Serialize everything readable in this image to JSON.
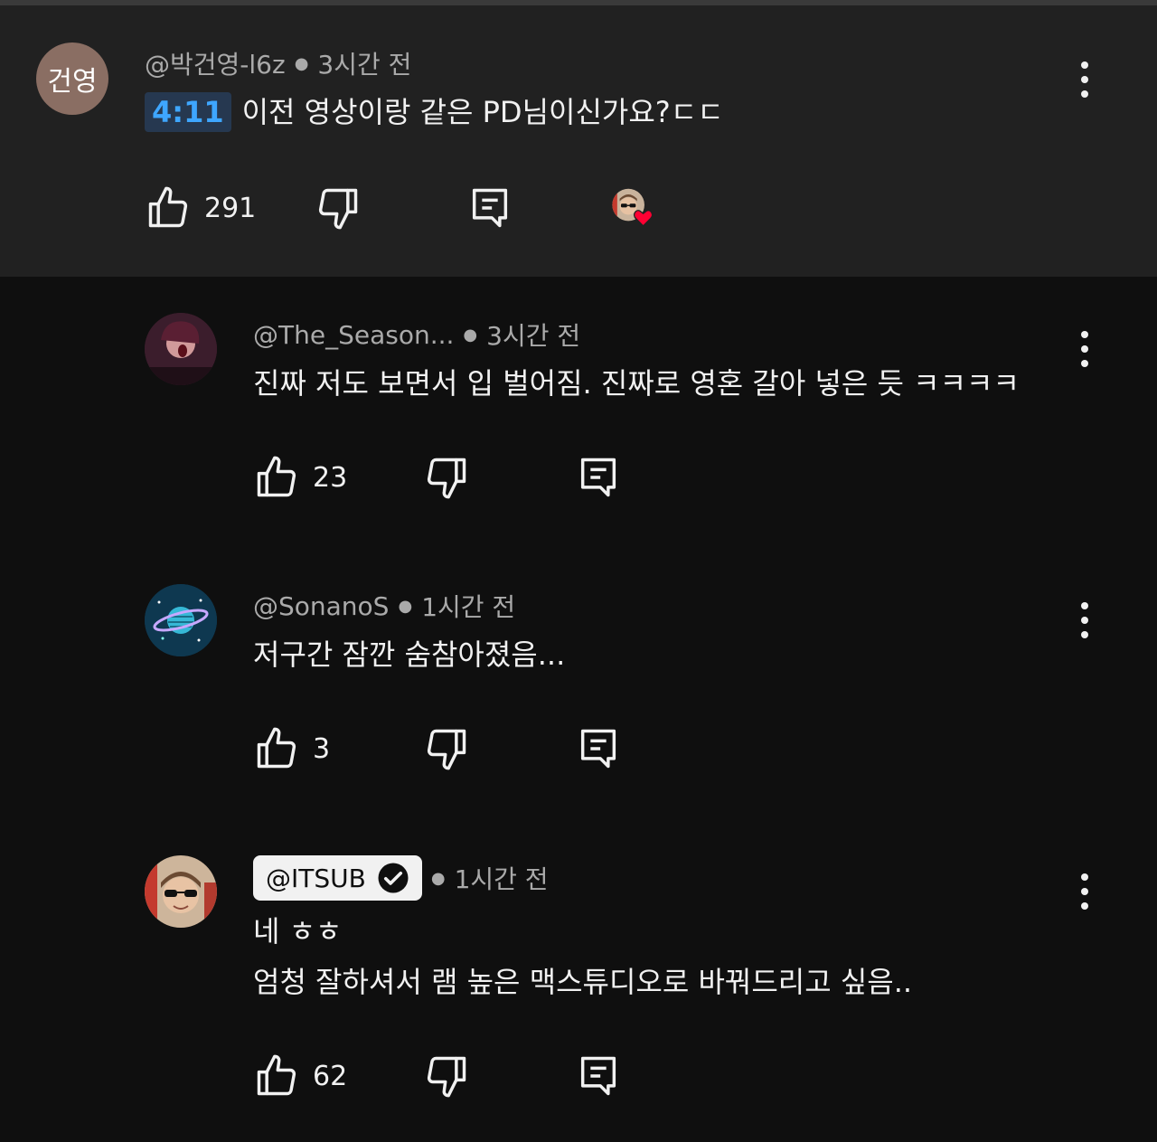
{
  "comments": [
    {
      "avatar_initials": "건영",
      "handle": "@박건영-l6z",
      "time": "3시간 전",
      "timestamp_link": "4:11",
      "text": "이전 영상이랑 같은 PD님이신가요?ㄷㄷ",
      "likes": "291",
      "creator_hearted": true
    },
    {
      "handle": "@The_Season...",
      "time": "3시간 전",
      "text": "진짜 저도 보면서 입 벌어짐. 진짜로 영혼 갈아 넣은 듯 ㅋㅋㅋㅋ",
      "likes": "23"
    },
    {
      "handle": "@SonanoS",
      "time": "1시간 전",
      "text": "저구간 잠깐 숨참아졌음...",
      "likes": "3"
    },
    {
      "handle": "@ITSUB",
      "time": "1시간 전",
      "text_line1": "네 ㅎㅎ",
      "text_line2": "엄청 잘하셔서 램 높은 맥스튜디오로 바꿔드리고 싶음..",
      "likes": "62",
      "verified": true
    }
  ],
  "icons": {
    "like": "thumbs-up-icon",
    "dislike": "thumbs-down-icon",
    "reply": "reply-icon",
    "more": "more-vert-icon",
    "heart": "heart-icon",
    "verified": "verified-check-icon"
  },
  "colors": {
    "background": "#0f0f0f",
    "highlight_background": "#212121",
    "timestamp_link": "#3ea6ff",
    "heart": "#ff0033"
  }
}
